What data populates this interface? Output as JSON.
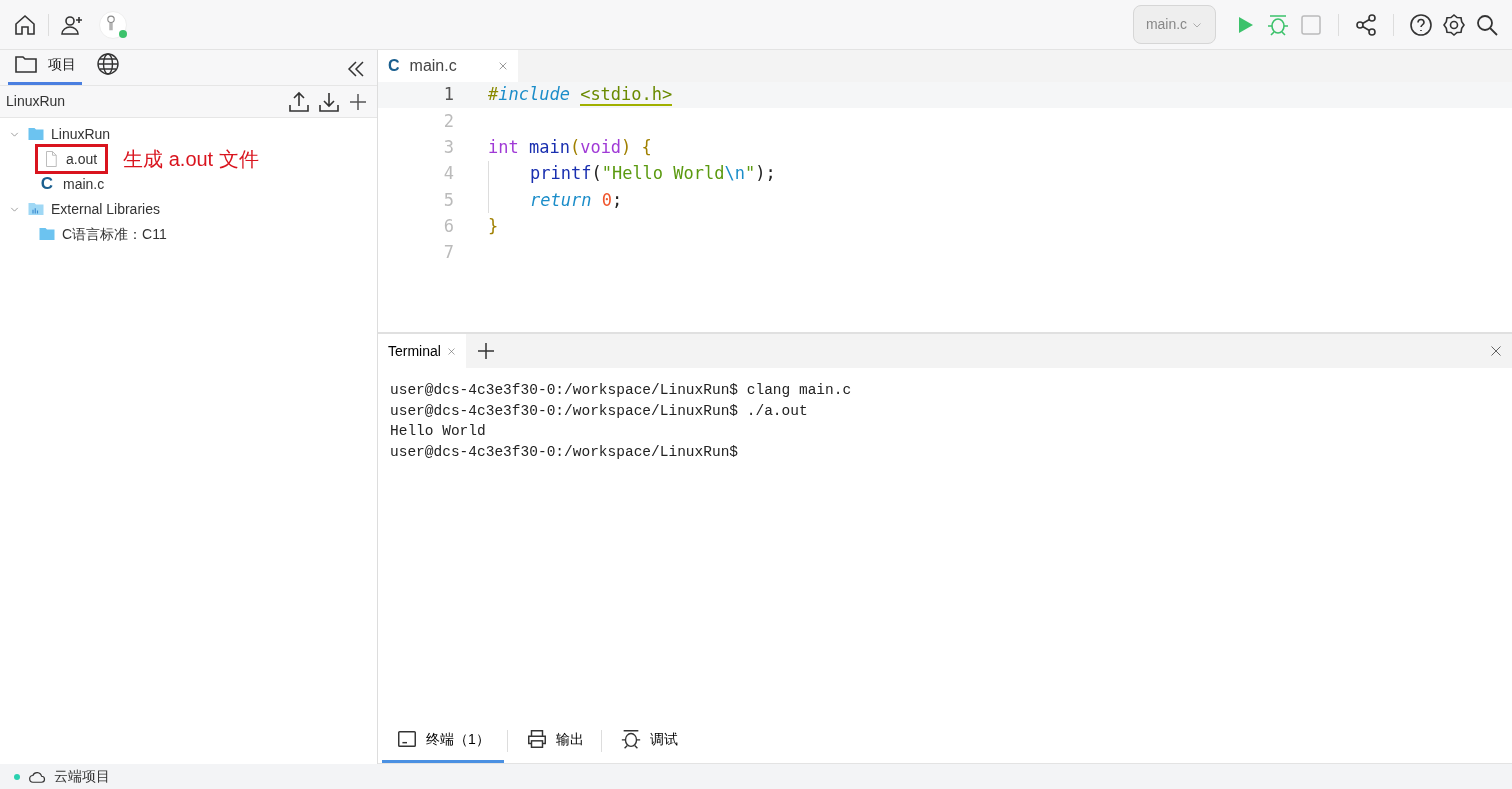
{
  "toolbar": {
    "run_target": "main.c",
    "avatar_online": true
  },
  "sidebar": {
    "tabs": [
      {
        "label": "项目",
        "kind": "folder",
        "selected": true
      },
      {
        "kind": "globe",
        "selected": false
      }
    ],
    "project_title": "LinuxRun",
    "tree": [
      {
        "label": "LinuxRun",
        "kind": "folder",
        "expanded": true,
        "children": [
          {
            "label": "a.out",
            "kind": "file",
            "highlighted": true,
            "annotation": "生成 a.out 文件"
          },
          {
            "label": "main.c",
            "kind": "c-file",
            "icon_letter": "C",
            "highlighted": false
          }
        ]
      },
      {
        "label": "External Libraries",
        "kind": "library",
        "expanded": true,
        "children": [
          {
            "label": "C语言标准：C11",
            "kind": "folder"
          }
        ]
      }
    ]
  },
  "editor": {
    "tabs": [
      {
        "label": "main.c",
        "icon_letter": "C",
        "selected": true
      }
    ],
    "lines": [
      {
        "number": "1",
        "current": true,
        "tokens": [
          {
            "text": "#",
            "kind": "directive"
          },
          {
            "text": "include ",
            "kind": "keyword-italic"
          },
          {
            "text": "<stdio.h>",
            "kind": "header"
          }
        ]
      },
      {
        "number": "2",
        "current": false
      },
      {
        "number": "3",
        "current": false,
        "tokens": [
          {
            "text": "int ",
            "kind": "type"
          },
          {
            "text": "main",
            "kind": "function"
          },
          {
            "text": "(",
            "kind": "paren"
          },
          {
            "text": "void",
            "kind": "type"
          },
          {
            "text": ") {",
            "kind": "paren"
          }
        ]
      },
      {
        "number": "4",
        "current": false,
        "indent": true,
        "tokens": [
          {
            "text": "printf",
            "kind": "function"
          },
          {
            "text": "(",
            "kind": "plain"
          },
          {
            "text": "\"Hello World",
            "kind": "string"
          },
          {
            "text": "\\n",
            "kind": "escape"
          },
          {
            "text": "\"",
            "kind": "string"
          },
          {
            "text": ");",
            "kind": "plain"
          }
        ]
      },
      {
        "number": "5",
        "current": false,
        "indent": true,
        "tokens": [
          {
            "text": "return ",
            "kind": "keyword-italic"
          },
          {
            "text": "0",
            "kind": "number"
          },
          {
            "text": ";",
            "kind": "plain"
          }
        ]
      },
      {
        "number": "6",
        "current": false,
        "tokens": [
          {
            "text": "}",
            "kind": "paren"
          }
        ]
      },
      {
        "number": "7",
        "current": false
      }
    ]
  },
  "terminal": {
    "tabs": [
      {
        "label": "Terminal",
        "selected": true
      }
    ],
    "lines": [
      "user@dcs-4c3e3f30-0:/workspace/LinuxRun$ clang main.c",
      "user@dcs-4c3e3f30-0:/workspace/LinuxRun$ ./a.out",
      "Hello World",
      "user@dcs-4c3e3f30-0:/workspace/LinuxRun$"
    ]
  },
  "bottom_tabs": [
    {
      "label": "终端（1）",
      "kind": "terminal",
      "selected": true
    },
    {
      "label": "输出",
      "kind": "printer",
      "selected": false
    },
    {
      "label": "调试",
      "kind": "bug",
      "selected": false
    }
  ],
  "status_bar": {
    "label": "云端项目",
    "connected": true
  }
}
